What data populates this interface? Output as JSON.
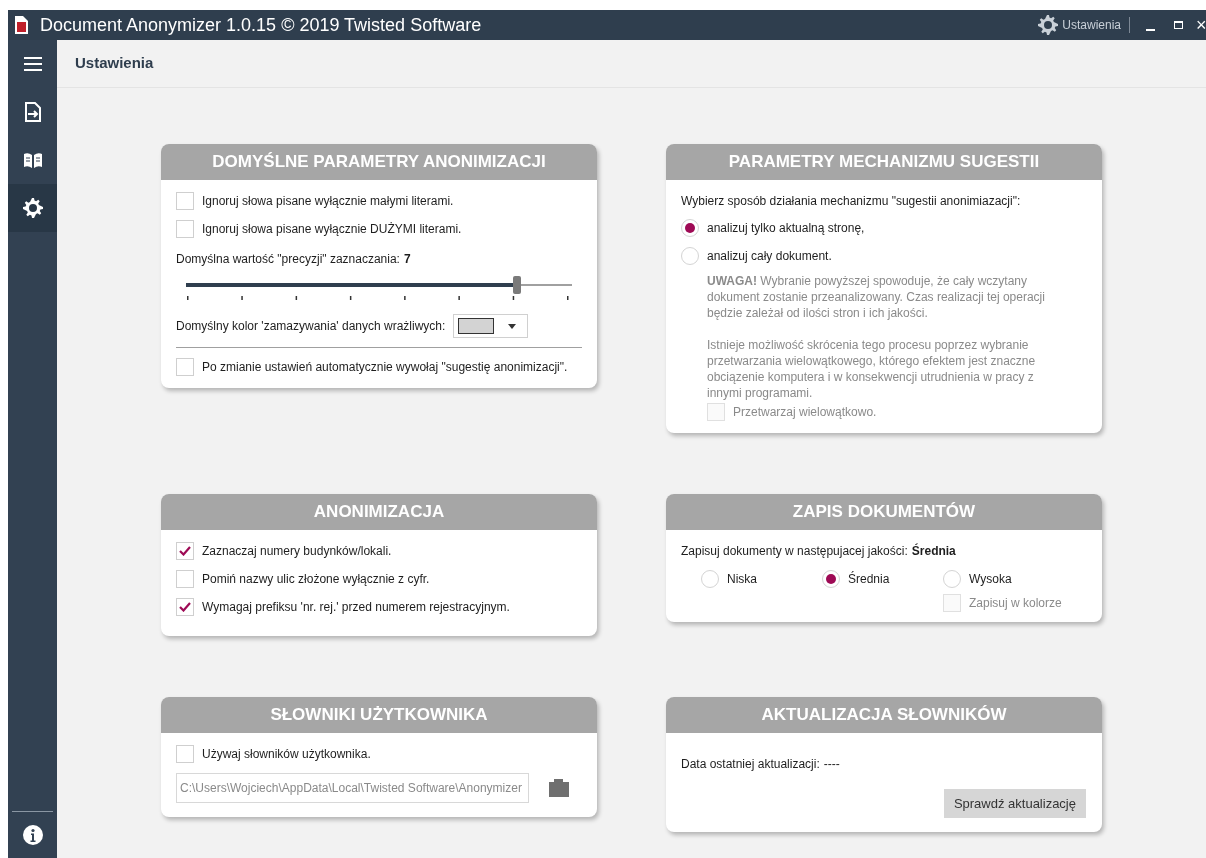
{
  "window": {
    "title": "Document Anonymizer 1.0.15 © 2019 Twisted Software",
    "settings_label": "Ustawienia",
    "close_glyph": "×"
  },
  "sidebar": {
    "items": [
      {
        "kind": "menu",
        "selected": false
      },
      {
        "kind": "import",
        "selected": false
      },
      {
        "kind": "book",
        "selected": false
      },
      {
        "kind": "settings",
        "selected": true
      }
    ],
    "footer": {
      "kind": "info"
    }
  },
  "page_title": "Ustawienia",
  "cards": [
    {
      "kind": "defaults",
      "title": "DOMYŚLNE PARAMETRY ANONIMIZACJI",
      "checkboxes": [
        {
          "label": "Ignoruj słowa pisane wyłącznie małymi literami.",
          "checked": false
        },
        {
          "label": "Ignoruj słowa pisane wyłącznie DUŻYMI literami.",
          "checked": false
        }
      ],
      "precision_label": "Domyślna wartość \"precyzji\" zaznaczania:",
      "precision_value": "7",
      "level": 0.857,
      "color_label": "Domyślny kolor 'zamazywania' danych wrażliwych:",
      "color": "#d3d3d3",
      "auto_checkbox": {
        "label": "Po zmianie ustawień automatycznie wywołaj \"sugestię anonimizacji\".",
        "checked": false
      }
    },
    {
      "kind": "suggest",
      "title": "PARAMETRY MECHANIZMU SUGESTII",
      "prompt": "Wybierz sposób działania mechanizmu \"sugestii anonimiazacji\":",
      "options": [
        {
          "label": "analizuj tylko aktualną stronę,",
          "selected": true
        },
        {
          "label": "analizuj cały dokument.",
          "selected": false
        }
      ],
      "warning": "**UWAGA!** Wybranie powyższej spowoduje, że cały wczytany dokument zostanie przeanalizowany. Czas realizacji tej operacji będzie zależał od ilości stron i ich jakości.",
      "info": "Istnieje możliwość skrócenia tego procesu poprzez wybranie przetwarzania wielowątkowego, którego efektem jest znaczne obciązenie komputera i w konsekwencji utrudnienia w pracy z innymi programami.",
      "multithread": {
        "label": "Przetwarzaj wielowątkowo.",
        "checked": false,
        "disabled": true
      }
    },
    {
      "kind": "anon",
      "title": "ANONIMIZACJA",
      "checkboxes": [
        {
          "label": "Zaznaczaj numery budynków/lokali.",
          "checked": true
        },
        {
          "label": "Pomiń nazwy ulic złożone wyłącznie z cyfr.",
          "checked": false
        },
        {
          "label": "Wymagaj prefiksu 'nr. rej.' przed numerem rejestracyjnym.",
          "checked": true
        }
      ]
    },
    {
      "kind": "save",
      "title": "ZAPIS DOKUMENTÓW",
      "prompt": "Zapisuj dokumenty w następujacej jakości:",
      "value": "Średnia",
      "options": [
        {
          "label": "Niska",
          "selected": false
        },
        {
          "label": "Średnia",
          "selected": true
        },
        {
          "label": "Wysoka",
          "selected": false
        }
      ],
      "color_checkbox": {
        "label": "Zapisuj w kolorze",
        "checked": false,
        "disabled": true
      }
    },
    {
      "kind": "dicts",
      "title": "SŁOWNIKI UŻYTKOWNIKA",
      "checkbox": {
        "label": "Używaj słowników użytkownika.",
        "checked": false
      },
      "path": "C:\\Users\\Wojciech\\AppData\\Local\\Twisted Software\\Anonymizer"
    },
    {
      "kind": "update",
      "title": "AKTUALIZACJA SŁOWNIKÓW",
      "label": "Data ostatniej aktualizacji:",
      "value": "----",
      "button": "Sprawdź aktualizację"
    }
  ]
}
